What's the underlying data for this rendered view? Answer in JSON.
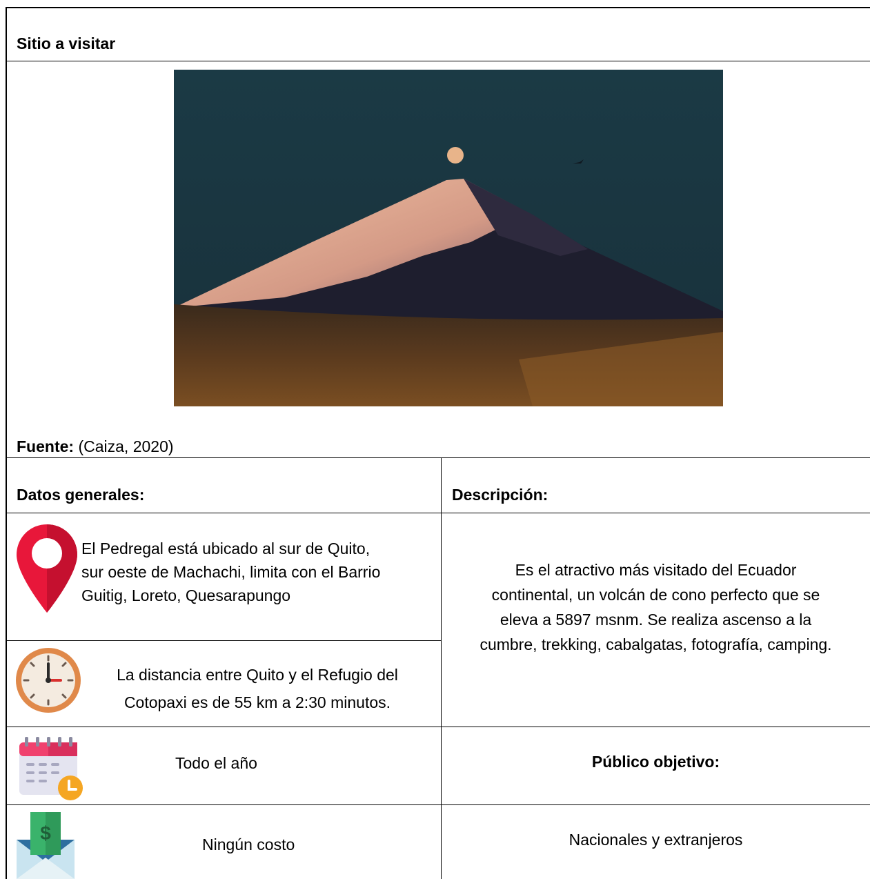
{
  "header": {
    "title": "Sitio a visitar"
  },
  "photo": {
    "subject": "snow-capped-volcano-with-moon"
  },
  "source": {
    "label": "Fuente:",
    "citation": "(Caiza, 2020)"
  },
  "columns": {
    "left_title": "Datos generales:",
    "right_title": "Descripción:"
  },
  "general": {
    "location_icon": "location-pin-icon",
    "location_lines": [
      "El Pedregal está ubicado al sur de Quito,",
      "sur oeste de Machachi, limita con el Barrio",
      "Guitig, Loreto, Quesarapungo"
    ],
    "time_icon": "clock-icon",
    "time_lines": [
      "La distancia entre Quito y el Refugio del",
      "Cotopaxi es de 55 km a 2:30 minutos."
    ],
    "season_icon": "calendar-clock-icon",
    "season": "Todo el año",
    "cost_icon": "money-envelope-icon",
    "cost": "Ningún costo"
  },
  "description": {
    "lines": [
      "Es el atractivo más visitado del Ecuador",
      "continental, un volcán de cono perfecto que se",
      "eleva a 5897 msnm. Se realiza ascenso a la",
      "cumbre, trekking, cabalgatas, fotografía, camping."
    ]
  },
  "audience": {
    "title": "Público objetivo:",
    "value": "Nacionales y extranjeros"
  },
  "colors": {
    "border": "#000000",
    "pin": "#e8173a",
    "clock_ring": "#e0894a",
    "calendar_top": "#f0416e",
    "money_green": "#3ab36b"
  }
}
